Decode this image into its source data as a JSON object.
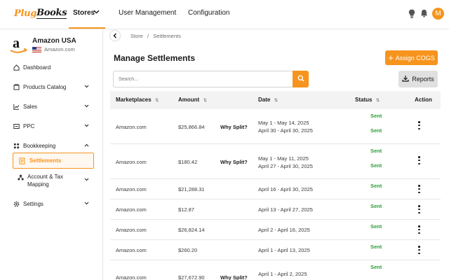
{
  "brand": {
    "logo_part1": "Plug",
    "logo_part2": "Books"
  },
  "topnav": {
    "stores": "Stores",
    "user_management": "User Management",
    "configuration": "Configuration",
    "avatar_initial": "M"
  },
  "store": {
    "name": "Amazon USA",
    "sub": "Amazon.com"
  },
  "sidebar": {
    "items": [
      {
        "label": "Dashboard",
        "icon": "home-icon"
      },
      {
        "label": "Products Catalog",
        "icon": "box-icon"
      },
      {
        "label": "Sales",
        "icon": "chart-icon"
      },
      {
        "label": "PPC",
        "icon": "ppc-icon"
      },
      {
        "label": "Bookkeeping",
        "icon": "bookkeeping-icon"
      },
      {
        "label": "Settlements",
        "icon": "document-icon"
      },
      {
        "label": "Account & Tax",
        "label2": "Mapping",
        "icon": "mapping-icon"
      },
      {
        "label": "Settings",
        "icon": "gear-icon"
      }
    ]
  },
  "breadcrumb": {
    "store": "Store",
    "sep": "/",
    "page": "Settlements"
  },
  "page_title": "Manage Settlements",
  "buttons": {
    "assign_cogs": "Assign COGS",
    "reports": "Reports"
  },
  "search": {
    "placeholder": "Search..."
  },
  "table": {
    "headers": {
      "marketplaces": "Marketplaces",
      "amount": "Amount",
      "date": "Date",
      "status": "Status",
      "action": "Action"
    },
    "rows": [
      {
        "marketplace": "Amazon.com",
        "amount": "$25,866.84",
        "split": "Why Split?",
        "date1": "May 1 - May 14, 2025",
        "date2": "April 30 - April 30, 2025",
        "status1": "Sent",
        "status2": "Sent"
      },
      {
        "marketplace": "Amazon.com",
        "amount": "$180.42",
        "split": "Why Split?",
        "date1": "May 1 - May 11, 2025",
        "date2": "April 27 - April 30, 2025",
        "status1": "Sent",
        "status2": "Sent"
      },
      {
        "marketplace": "Amazon.com",
        "amount": "$21,288.31",
        "date1": "April 16 - April 30, 2025",
        "status1": "Sent"
      },
      {
        "marketplace": "Amazon.com",
        "amount": "$12.87",
        "date1": "April 13 - April 27, 2025",
        "status1": "Sent"
      },
      {
        "marketplace": "Amazon.com",
        "amount": "$26,824.14",
        "date1": "April 2 - April 16, 2025",
        "status1": "Sent"
      },
      {
        "marketplace": "Amazon.com",
        "amount": "$260.20",
        "date1": "April 1 - April 13, 2025",
        "status1": "Sent"
      },
      {
        "marketplace": "Amazon.com",
        "amount": "$27,672.90",
        "split": "Why Split?",
        "date1": "April 1 - April 2, 2025",
        "status1": "Sent"
      }
    ]
  },
  "colors": {
    "accent": "#f7941d",
    "sent": "#2e9e3a"
  }
}
